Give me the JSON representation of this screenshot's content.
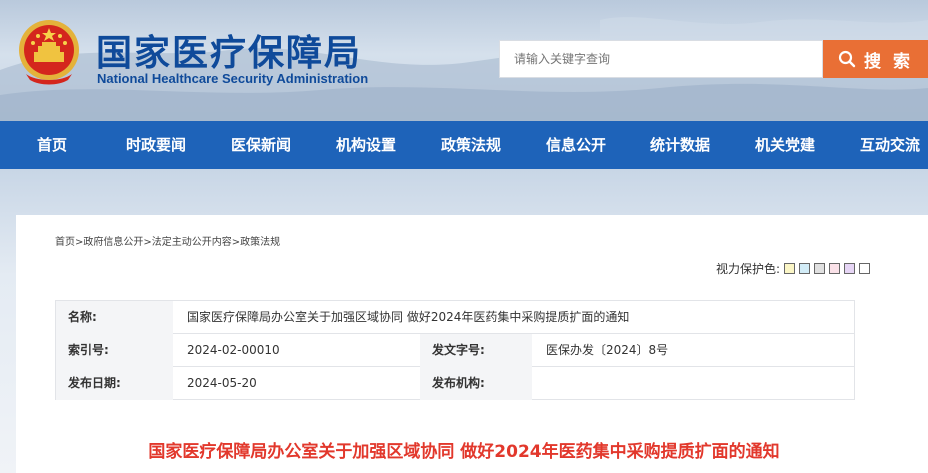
{
  "header": {
    "logo_cn": "国家医疗保障局",
    "logo_en": "National Healthcare Security Administration",
    "emblem_icon": "national-emblem-icon",
    "search_placeholder": "请输入关键字查询",
    "search_button": "搜 索",
    "search_icon": "search-icon",
    "accent_color": "#e96f35"
  },
  "nav": {
    "color": "#1e63b9",
    "items": [
      "首页",
      "时政要闻",
      "医保新闻",
      "机构设置",
      "政策法规",
      "信息公开",
      "统计数据",
      "机关党建",
      "互动交流"
    ]
  },
  "breadcrumb": [
    "首页",
    "政府信息公开",
    "法定主动公开内容",
    "政策法规"
  ],
  "breadcrumb_sep": ">",
  "vision": {
    "label": "视力保护色:",
    "swatches": [
      "#fbf6c6",
      "#d2ecf7",
      "#e0e0e0",
      "#fae1e8",
      "#e6d5f5",
      "#ffffff"
    ]
  },
  "info": {
    "name_label": "名称:",
    "name_value": "国家医疗保障局办公室关于加强区域协同 做好2024年医药集中采购提质扩面的通知",
    "index_label": "索引号:",
    "index_value": "2024-02-00010",
    "docno_label": "发文字号:",
    "docno_value": "医保办发〔2024〕8号",
    "date_label": "发布日期:",
    "date_value": "2024-05-20",
    "org_label": "发布机构:",
    "org_value": ""
  },
  "doc_title": "国家医疗保障局办公室关于加强区域协同 做好2024年医药集中采购提质扩面的通知",
  "title_color": "#e2382c"
}
